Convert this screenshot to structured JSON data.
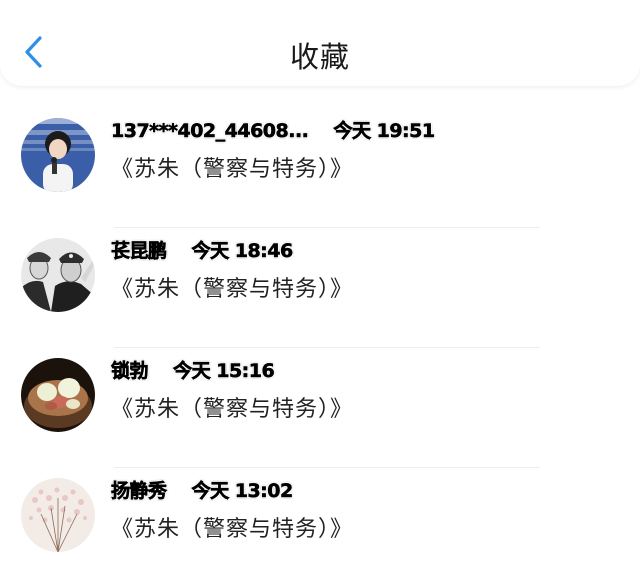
{
  "header": {
    "title": "收藏",
    "back_icon": "chevron-left-icon",
    "accent_color": "#2f8fe6"
  },
  "favorites": [
    {
      "name": "137***402_44608...",
      "time": "今天 19:51",
      "content": "《苏朱（警察与特务）》",
      "avatar": "avatar-singer-photo"
    },
    {
      "name": "苌昆鹏",
      "time": "今天 18:46",
      "content": "《苏朱（警察与特务）》",
      "avatar": "avatar-police-saluting"
    },
    {
      "name": "锁勃",
      "time": "今天 15:16",
      "content": "《苏朱（警察与特务）》",
      "avatar": "avatar-food-bowl"
    },
    {
      "name": "扬静秀",
      "time": "今天 13:02",
      "content": "《苏朱（警察与特务）》",
      "avatar": "avatar-flowers"
    }
  ]
}
